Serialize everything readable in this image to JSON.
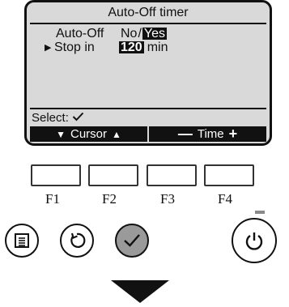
{
  "screen": {
    "title": "Auto-Off timer",
    "rows": [
      {
        "label": "Auto-Off",
        "options": {
          "no": "No",
          "slash": "/",
          "yes": "Yes"
        }
      },
      {
        "label": "Stop in",
        "value": "120",
        "unit": "min"
      }
    ],
    "select_label": "Select:"
  },
  "function_bar": {
    "cursor_label": "Cursor",
    "time_label": "Time"
  },
  "function_keys": [
    "F1",
    "F2",
    "F3",
    "F4"
  ],
  "icons": {
    "menu": "menu-icon",
    "back": "return-icon",
    "confirm": "check-icon",
    "power": "power-icon",
    "next": "down-arrow-icon"
  },
  "colors": {
    "lcd_background": "#d9d9d9",
    "confirm_button": "#9a9a9a",
    "led": "#8a8a8a"
  }
}
